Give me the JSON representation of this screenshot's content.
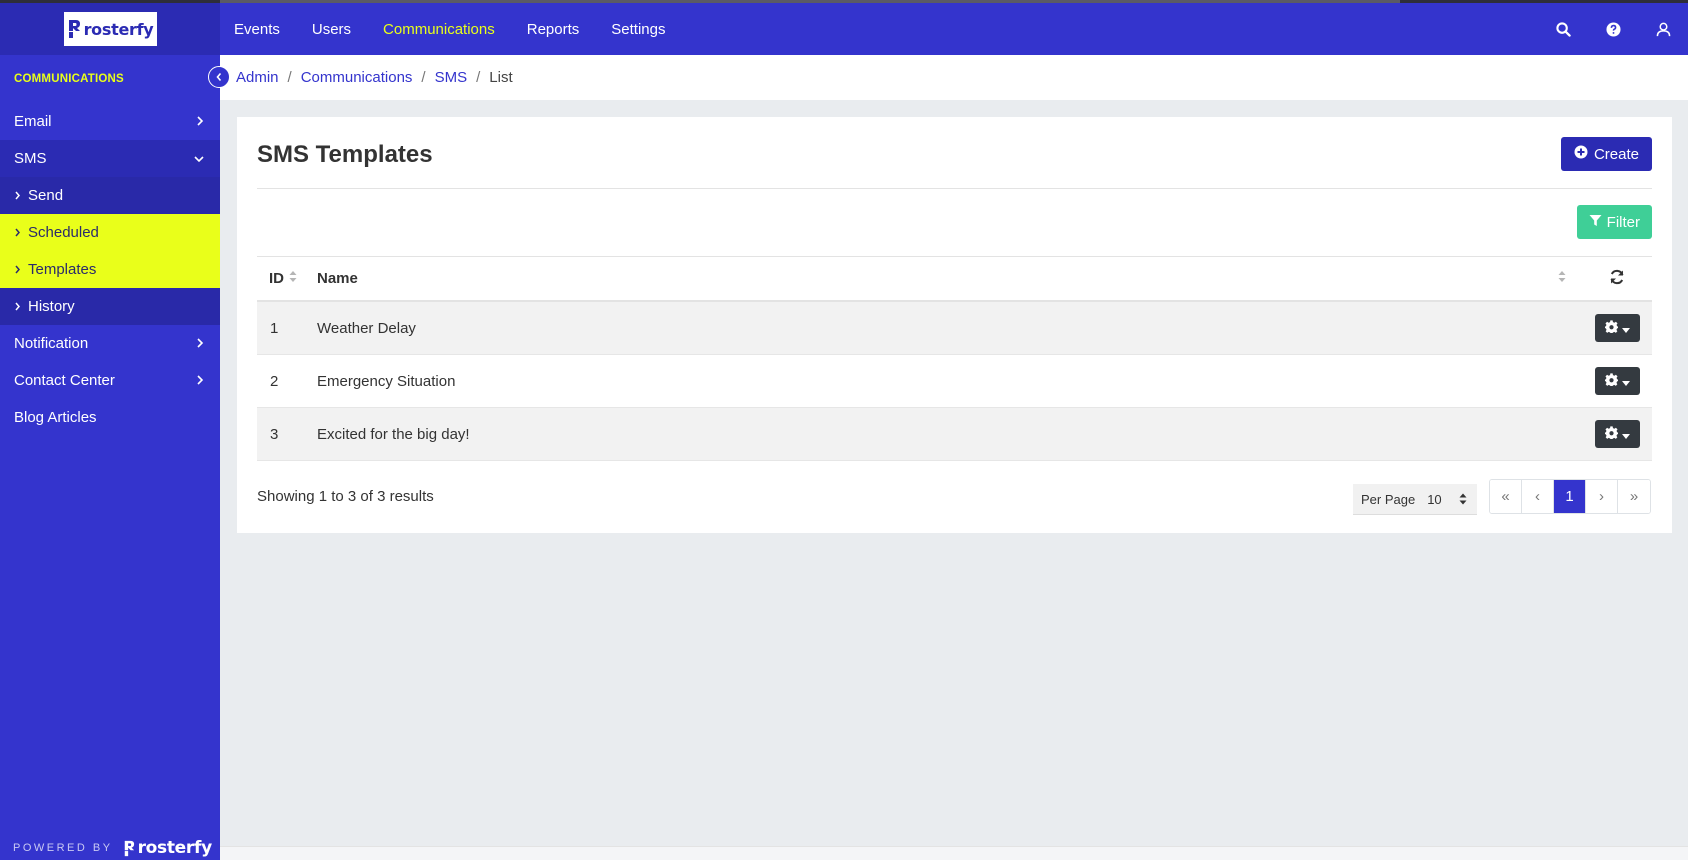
{
  "app": {
    "logo_text": "rosterfy",
    "powered_by": "POWERED BY"
  },
  "sidebar": {
    "section": "COMMUNICATIONS",
    "items": [
      {
        "label": "Email"
      },
      {
        "label": "SMS"
      },
      {
        "label": "Notification"
      },
      {
        "label": "Contact Center"
      },
      {
        "label": "Blog Articles"
      }
    ],
    "sms_sub": [
      {
        "label": "Send"
      },
      {
        "label": "Scheduled"
      },
      {
        "label": "Templates"
      },
      {
        "label": "History"
      }
    ]
  },
  "topnav": {
    "items": [
      {
        "label": "Events"
      },
      {
        "label": "Users"
      },
      {
        "label": "Communications"
      },
      {
        "label": "Reports"
      },
      {
        "label": "Settings"
      }
    ]
  },
  "breadcrumb": {
    "admin": "Admin",
    "communications": "Communications",
    "sms": "SMS",
    "current": "List",
    "sep": "/"
  },
  "page": {
    "title": "SMS Templates",
    "create_label": "Create",
    "filter_label": "Filter"
  },
  "table": {
    "headers": {
      "id": "ID",
      "name": "Name"
    },
    "rows": [
      {
        "id": "1",
        "name": "Weather Delay"
      },
      {
        "id": "2",
        "name": "Emergency Situation"
      },
      {
        "id": "3",
        "name": "Excited for the big day!"
      }
    ]
  },
  "pagination": {
    "showing": "Showing 1 to 3 of 3 results",
    "per_page_label": "Per Page",
    "per_page_value": "10",
    "first": "«",
    "prev": "‹",
    "current": "1",
    "next": "›",
    "last": "»"
  },
  "colors": {
    "brand": "#3434cd",
    "brand_dark": "#2b2bb3",
    "highlight": "#e9ff1a",
    "filter": "#3fcf97",
    "gear_btn": "#343a40"
  }
}
